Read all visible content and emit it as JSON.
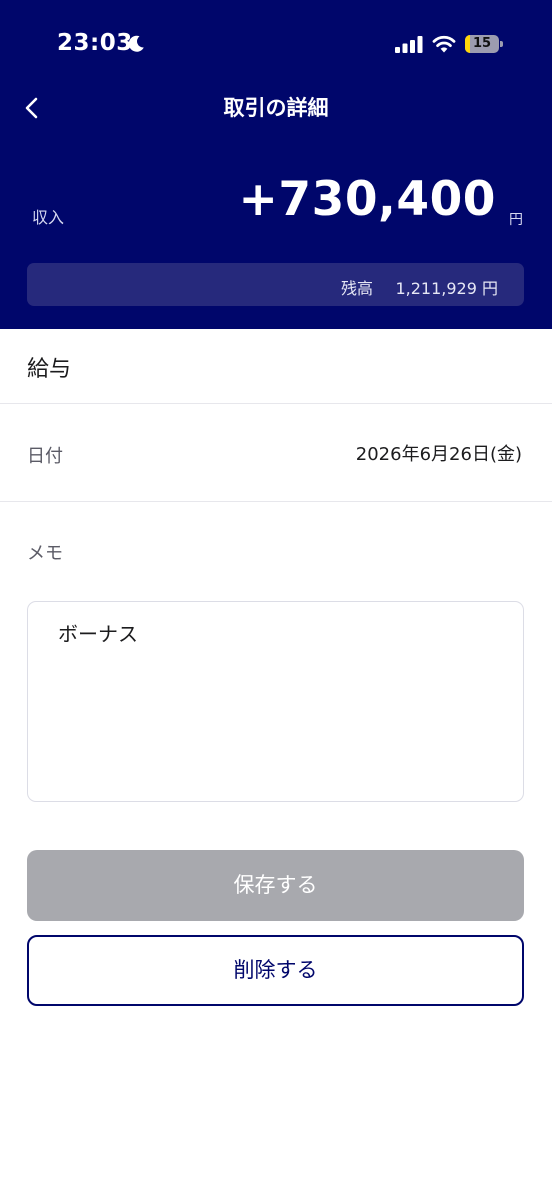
{
  "status_bar": {
    "time": "23:03",
    "moon_icon": "moon-icon",
    "signal_icon": "cellular-signal-icon",
    "wifi_icon": "wifi-icon",
    "battery_level": "15",
    "battery_fill_fraction": 0.15,
    "battery_color": "#ffd60a"
  },
  "nav": {
    "back_icon": "chevron-left-icon",
    "title": "取引の詳細"
  },
  "summary": {
    "type_label": "収入",
    "amount": "+730,400",
    "unit": "円",
    "balance_label": "残高",
    "balance_value": "1,211,929 円"
  },
  "detail": {
    "category": "給与",
    "date_label": "日付",
    "date_value": "2026年6月26日(金)",
    "memo_label": "メモ",
    "memo_value": "ボーナス"
  },
  "actions": {
    "save_label": "保存する",
    "delete_label": "削除する"
  },
  "colors": {
    "header_background": "#00066b",
    "balance_background": "#26297c",
    "save_disabled": "#a8a9ae",
    "delete_accent": "#00066b"
  }
}
